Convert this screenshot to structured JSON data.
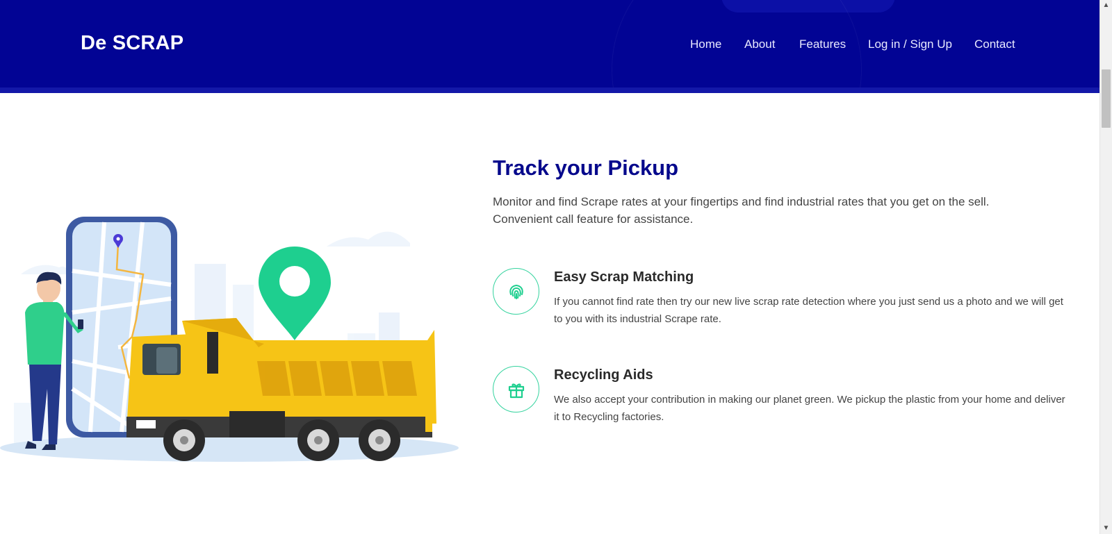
{
  "header": {
    "logo": "De SCRAP",
    "nav": [
      {
        "label": "Home"
      },
      {
        "label": "About"
      },
      {
        "label": "Features"
      },
      {
        "label": "Log in / Sign Up"
      },
      {
        "label": "Contact"
      }
    ]
  },
  "section": {
    "title": "Track your Pickup",
    "description": "Monitor and find Scrape rates at your fingertips and find industrial rates that you get on the sell. Convenient call feature for assistance.",
    "features": [
      {
        "icon": "fingerprint-icon",
        "title": "Easy Scrap Matching",
        "text": "If you cannot find rate then try our new live scrap rate detection where you just send us a photo and we will get to you with its industrial Scrape rate."
      },
      {
        "icon": "gift-icon",
        "title": "Recycling Aids",
        "text": "We also accept your contribution in making our planet green. We pickup the plastic from your home and deliver it to Recycling factories."
      }
    ]
  },
  "colors": {
    "header_bg": "#020494",
    "title": "#06098c",
    "accent_green": "#1ecf8f",
    "truck_yellow": "#f6c416"
  }
}
